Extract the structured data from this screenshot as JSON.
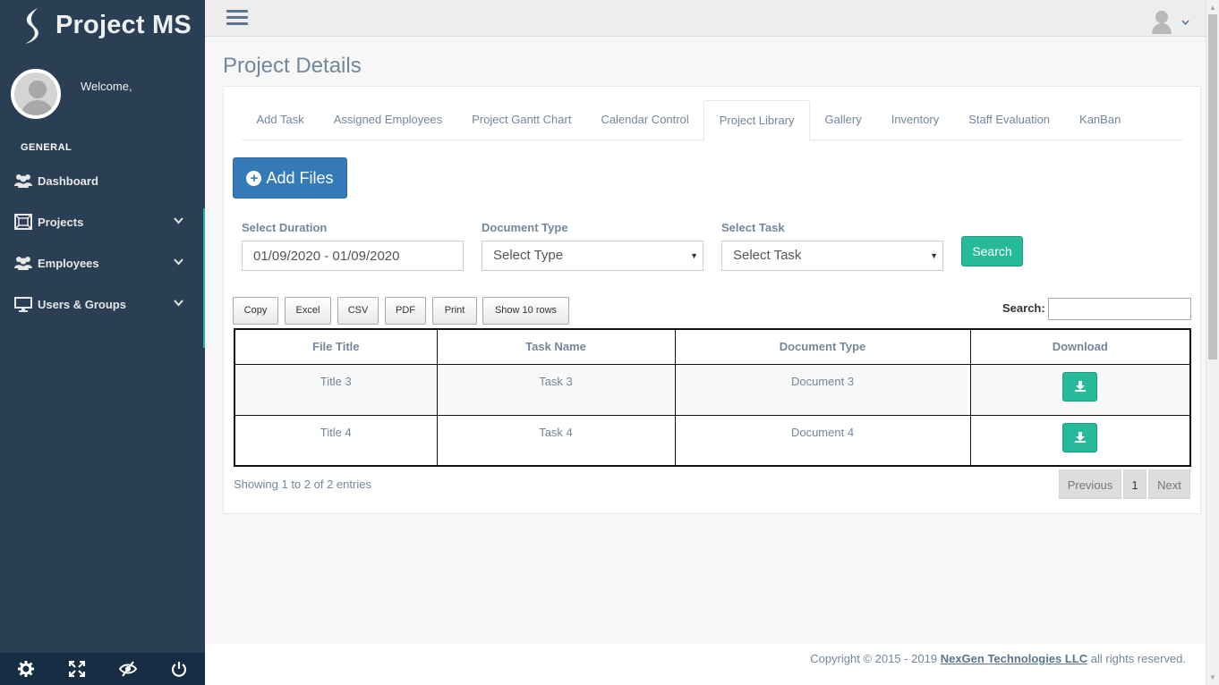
{
  "brand": {
    "name": "Project MS"
  },
  "profile": {
    "welcome": "Welcome,"
  },
  "sidebar": {
    "section_title": "GENERAL",
    "items": [
      {
        "label": "Dashboard",
        "icon": "users-icon"
      },
      {
        "label": "Projects",
        "icon": "projects-icon",
        "expandable": true
      },
      {
        "label": "Employees",
        "icon": "users-icon",
        "expandable": true
      },
      {
        "label": "Users & Groups",
        "icon": "desktop-icon",
        "expandable": true
      }
    ],
    "footer_icons": [
      "settings-icon",
      "fullscreen-icon",
      "eye-slash-icon",
      "power-icon"
    ]
  },
  "page": {
    "title": "Project Details"
  },
  "tabs": [
    {
      "label": "Add Task"
    },
    {
      "label": "Assigned Employees"
    },
    {
      "label": "Project Gantt Chart"
    },
    {
      "label": "Calendar Control"
    },
    {
      "label": "Project Library",
      "active": true
    },
    {
      "label": "Gallery"
    },
    {
      "label": "Inventory"
    },
    {
      "label": "Staff Evaluation"
    },
    {
      "label": "KanBan"
    }
  ],
  "add_files": {
    "label": "Add Files"
  },
  "filters": {
    "duration": {
      "label": "Select Duration",
      "value": "01/09/2020 - 01/09/2020"
    },
    "doc_type": {
      "label": "Document Type",
      "value": "Select Type"
    },
    "task": {
      "label": "Select Task",
      "value": "Select Task"
    },
    "search_label": "Search"
  },
  "table_tools": {
    "buttons": [
      "Copy",
      "Excel",
      "CSV",
      "PDF",
      "Print",
      "Show 10 rows"
    ],
    "search_label": "Search:",
    "search_value": ""
  },
  "table": {
    "headers": [
      "File Title",
      "Task Name",
      "Document Type",
      "Download"
    ],
    "rows": [
      {
        "file_title": "Title 3",
        "task_name": "Task 3",
        "document_type": "Document 3"
      },
      {
        "file_title": "Title 4",
        "task_name": "Task 4",
        "document_type": "Document 4"
      }
    ]
  },
  "pagination": {
    "info": "Showing 1 to 2 of 2 entries",
    "previous": "Previous",
    "page": "1",
    "next": "Next"
  },
  "footer": {
    "prefix": "Copyright © 2015 - 2019",
    "company": "NexGen Technologies LLC",
    "suffix": "all rights reserved."
  },
  "colors": {
    "sidebar_bg": "#2a3f54",
    "accent_green": "#26b99a",
    "primary_blue": "#337ab7",
    "text": "#73879c"
  }
}
